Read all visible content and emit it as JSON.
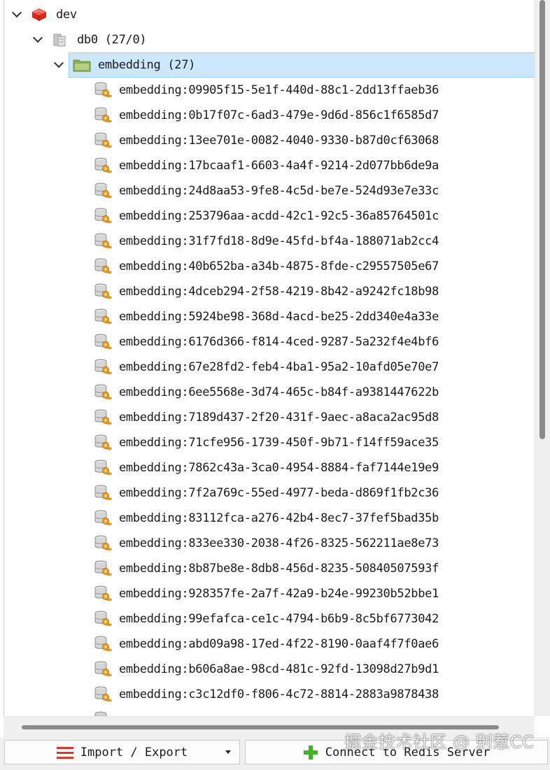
{
  "tree": {
    "server": {
      "label": "dev",
      "icon": "redis-server-icon"
    },
    "database": {
      "label": "db0  (27/0)",
      "icon": "database-icon"
    },
    "namespace": {
      "label": "embedding (27)",
      "icon": "folder-icon"
    },
    "keys": [
      "embedding:09905f15-5e1f-440d-88c1-2dd13ffaeb36",
      "embedding:0b17f07c-6ad3-479e-9d6d-856c1f6585d7",
      "embedding:13ee701e-0082-4040-9330-b87d0cf63068",
      "embedding:17bcaaf1-6603-4a4f-9214-2d077bb6de9a",
      "embedding:24d8aa53-9fe8-4c5d-be7e-524d93e7e33c",
      "embedding:253796aa-acdd-42c1-92c5-36a85764501c",
      "embedding:31f7fd18-8d9e-45fd-bf4a-188071ab2cc4",
      "embedding:40b652ba-a34b-4875-8fde-c29557505e67",
      "embedding:4dceb294-2f58-4219-8b42-a9242fc18b98",
      "embedding:5924be98-368d-4acd-be25-2dd340e4a33e",
      "embedding:6176d366-f814-4ced-9287-5a232f4e4bf6",
      "embedding:67e28fd2-feb4-4ba1-95a2-10afd05e70e7",
      "embedding:6ee5568e-3d74-465c-b84f-a9381447622b",
      "embedding:7189d437-2f20-431f-9aec-a8aca2ac95d8",
      "embedding:71cfe956-1739-450f-9b71-f14ff59ace35",
      "embedding:7862c43a-3ca0-4954-8884-faf7144e19e9",
      "embedding:7f2a769c-55ed-4977-beda-d869f1fb2c36",
      "embedding:83112fca-a276-42b4-8ec7-37fef5bad35b",
      "embedding:833ee330-2038-4f26-8325-562211ae8e73",
      "embedding:8b87be8e-8db8-456d-8235-50840507593f",
      "embedding:928357fe-2a7f-42a9-b24e-99230b52bbe1",
      "embedding:99efafca-ce1c-4794-b6b9-8c5bf6773042",
      "embedding:abd09a98-17ed-4f22-8190-0aaf4f7f0ae6",
      "embedding:b606a8ae-98cd-481c-92fd-13098d27b9d1",
      "embedding:c3c12df0-f806-4c72-8814-2883a9878438"
    ]
  },
  "toolbar": {
    "import_export_label": "Import / Export",
    "connect_label": "Connect to Redis Server"
  },
  "watermark": "掘金技术社区 @ 别惹CC",
  "colors": {
    "selection_bg": "#cce8ff",
    "selection_border": "#99d1ff",
    "redis_red": "#d32a1f",
    "folder_green": "#8fae58",
    "key_orange": "#f0a21c",
    "plus_green": "#43b02a"
  }
}
